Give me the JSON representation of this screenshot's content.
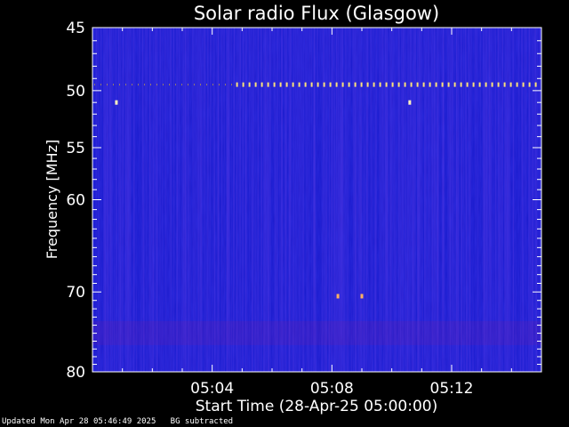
{
  "chart_data": {
    "type": "heatmap",
    "title": "Solar radio Flux (Glasgow)",
    "xlabel": "Start Time (28-Apr-25 05:00:00)",
    "ylabel": "Frequency [MHz]",
    "x_ticks": [
      "05:04",
      "05:08",
      "05:12"
    ],
    "x_tick_minutes": [
      4,
      8,
      12
    ],
    "xlim_minutes": [
      0,
      15
    ],
    "y_ticks": [
      45,
      50,
      55,
      60,
      70,
      80
    ],
    "ylim": [
      45,
      80
    ],
    "y_scale": "log",
    "features": [
      {
        "name": "interference-line",
        "freq_mhz": 49.5,
        "from_minute": 4.8,
        "to_minute": 15
      },
      {
        "name": "interference-dot",
        "freq_mhz": 51.0,
        "minute": 0.8
      },
      {
        "name": "interference-dot",
        "freq_mhz": 51.0,
        "minute": 10.6
      },
      {
        "name": "interference-dot",
        "freq_mhz": 70.5,
        "minute": 8.2
      },
      {
        "name": "interference-dot",
        "freq_mhz": 70.5,
        "minute": 9.0
      }
    ],
    "colors": {
      "background": "#1a1acc",
      "frame": "#ffffff",
      "line": "#ffe27a"
    },
    "grid": false
  },
  "footer": {
    "updated": "Updated Mon Apr 28 05:46:49 2025",
    "note": "BG subtracted"
  }
}
